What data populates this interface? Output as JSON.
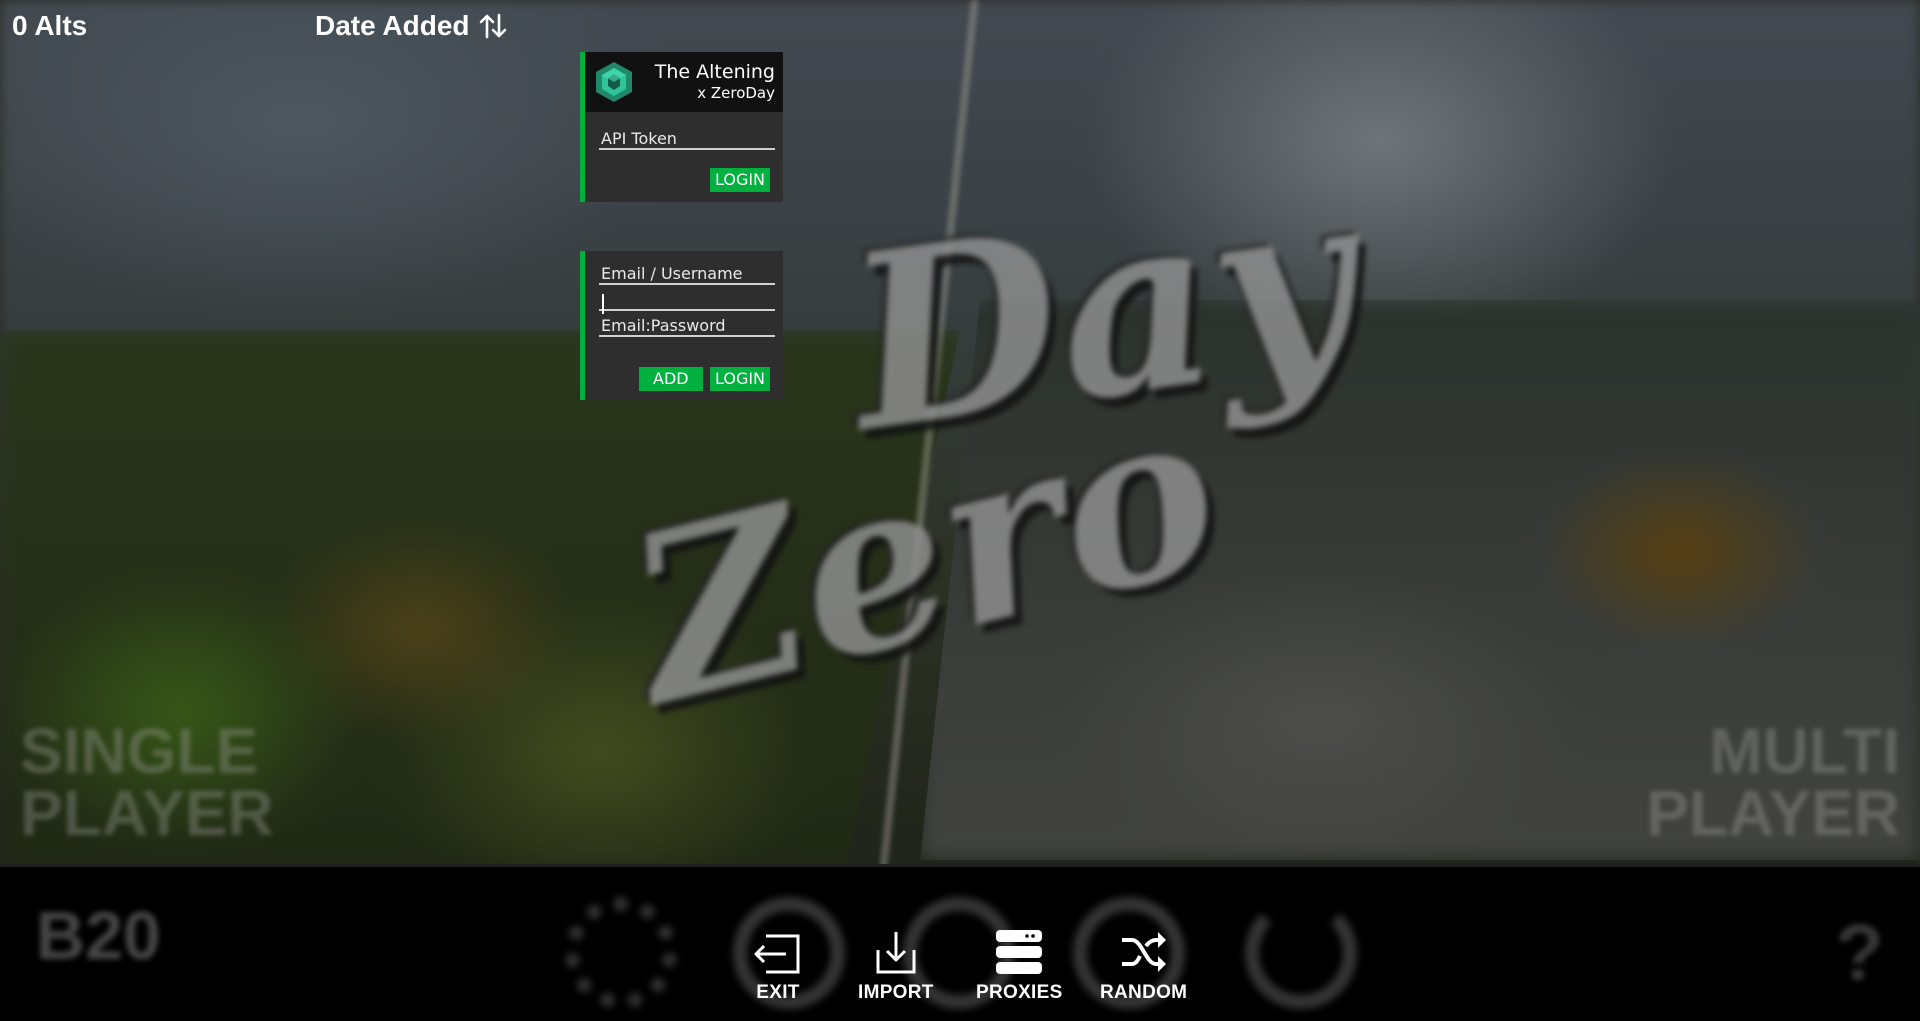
{
  "top": {
    "alt_count": "0 Alts",
    "sort_label": "Date Added",
    "sort_icon": "swap-vertical-icon"
  },
  "altening_panel": {
    "title": "The Altening",
    "subtitle": "x ZeroDay",
    "logo_icon": "altening-hexagon-icon",
    "api_token_placeholder": "API Token",
    "api_token_value": "",
    "login_label": "LOGIN"
  },
  "login_panel": {
    "email_placeholder": "Email / Username",
    "email_value": "",
    "password_value": "",
    "combo_placeholder": "Email:Password",
    "combo_value": "",
    "add_label": "ADD",
    "login_label": "LOGIN"
  },
  "bottom_actions": [
    {
      "label": "EXIT",
      "icon": "exit-icon"
    },
    {
      "label": "IMPORT",
      "icon": "import-icon"
    },
    {
      "label": "PROXIES",
      "icon": "proxies-icon"
    },
    {
      "label": "RANDOM",
      "icon": "shuffle-icon"
    }
  ],
  "background": {
    "logo_word_top": "Day",
    "logo_word_bottom": "Zero",
    "left_mode_line1": "SINGLE",
    "left_mode_line2": "PLAYER",
    "right_mode_line1": "MULTI",
    "right_mode_line2": "PLAYER",
    "version": "B20",
    "help_glyph": "?"
  },
  "colors": {
    "accent": "#00b140",
    "panel_bg": "#2e2e2e",
    "header_bg": "#111111"
  }
}
